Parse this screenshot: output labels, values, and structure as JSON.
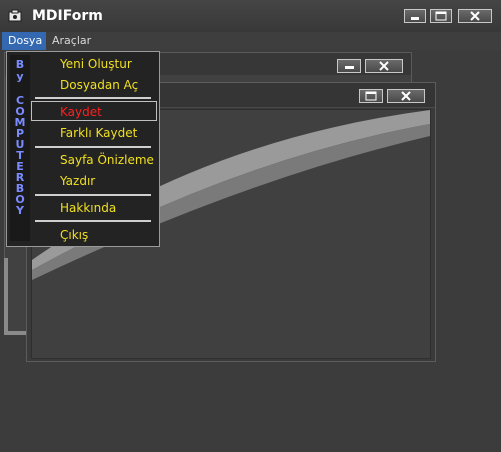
{
  "window": {
    "title": "MDIForm"
  },
  "menubar": {
    "items": [
      {
        "label": "Dosya"
      },
      {
        "label": "Araçlar"
      }
    ]
  },
  "file_menu": {
    "side_text": [
      "B",
      "y",
      " ",
      "C",
      "O",
      "M",
      "P",
      "U",
      "T",
      "E",
      "R",
      "B",
      "O",
      "Y"
    ],
    "items": [
      {
        "label": "Yeni Oluştur"
      },
      {
        "label": "Dosyadan Aç"
      },
      {
        "label": "Kaydet",
        "selected": true
      },
      {
        "label": "Farklı Kaydet"
      },
      {
        "label": "Sayfa Önizleme"
      },
      {
        "label": "Yazdır"
      },
      {
        "label": "Hakkında"
      },
      {
        "label": "Çıkış"
      }
    ]
  },
  "colors": {
    "menu_item_text": "#f0e020",
    "selected_item_text": "#ff2020",
    "side_text": "#7a8cff",
    "menubar_active": "#3468b0"
  },
  "icons": [
    "app-icon",
    "minimize-icon",
    "maximize-icon",
    "close-icon",
    "restore-icon"
  ]
}
